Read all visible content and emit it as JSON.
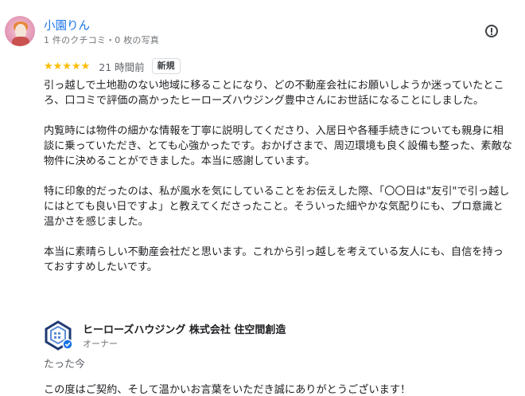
{
  "reviewer": {
    "name": "小園りん",
    "meta": "1 件のクチコミ・0 枚の写真"
  },
  "rating": {
    "stars": "★★★★★",
    "value": 5,
    "time": "21 時間前",
    "badge": "新規"
  },
  "review": {
    "paragraphs": [
      "引っ越しで土地勘のない地域に移ることになり、どの不動産会社にお願いしようか迷っていたところ、口コミで評価の高かったヒーローズハウジング豊中さんにお世話になることにしました。",
      "内覧時には物件の細かな情報を丁寧に説明してくださり、入居日や各種手続きについても親身に相談に乗っていただき、とても心強かったです。おかげさまで、周辺環境も良く設備も整った、素敵な物件に決めることができました。本当に感謝しています。",
      "特に印象的だったのは、私が風水を気にしていることをお伝えした際、「〇〇日は\"友引\"で引っ越しにはとても良い日ですよ」と教えてくださったこと。そういった細やかな気配りにも、プロ意識と温かさを感じました。",
      "本当に素晴らしい不動産会社だと思います。これから引っ越しを考えている友人にも、自信を持っておすすめしたいです。"
    ]
  },
  "owner": {
    "name": "ヒーローズハウジング 株式会社 住空間創造",
    "role": "オーナー",
    "reply_time": "たった今",
    "reply_text": "この度はご契約、そして温かいお言葉をいただき誠にありがとうございます！"
  },
  "colors": {
    "link": "#1a73e8",
    "star": "#fbbc04",
    "secondary_text": "#70757a",
    "verified": "#1a73e8"
  }
}
